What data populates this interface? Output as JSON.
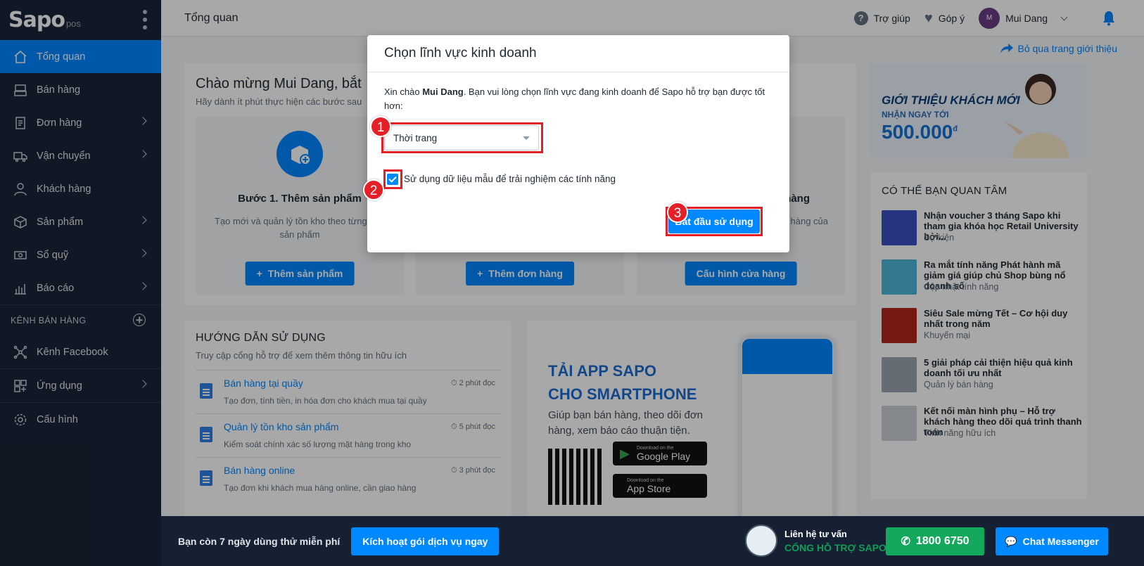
{
  "logo": {
    "brand": "Sapo",
    "suffix": "pos"
  },
  "sidebar": {
    "items": [
      {
        "label": "Tổng quan",
        "icon": "home-icon",
        "active": true
      },
      {
        "label": "Bán hàng",
        "icon": "pos-icon"
      },
      {
        "label": "Đơn hàng",
        "icon": "order-icon"
      },
      {
        "label": "Vận chuyển",
        "icon": "truck-icon"
      },
      {
        "label": "Khách hàng",
        "icon": "user-icon"
      },
      {
        "label": "Sản phẩm",
        "icon": "box-icon"
      },
      {
        "label": "Sổ quỹ",
        "icon": "cash-icon"
      },
      {
        "label": "Báo cáo",
        "icon": "chart-icon"
      }
    ],
    "section_title": "KÊNH BÁN HÀNG",
    "channels": [
      {
        "label": "Kênh Facebook",
        "icon": "facebook-network-icon"
      }
    ],
    "bottom_items": [
      {
        "label": "Ứng dụng",
        "icon": "apps-icon"
      },
      {
        "label": "Cấu hình",
        "icon": "gear-icon"
      }
    ]
  },
  "header": {
    "title": "Tổng quan",
    "help": "Trợ giúp",
    "feedback": "Góp ý",
    "avatar_initial": "M",
    "user_name": "Mui Dang"
  },
  "skip_intro": "Bỏ qua trang giới thiệu",
  "welcome": {
    "title": "Chào mừng Mui Dang, bắt",
    "subtitle": "Hãy dành ít phút thực hiện các bước sau",
    "steps": [
      {
        "title": "Bước 1. Thêm sản phẩm",
        "desc": "Tạo mới và quản lý tồn kho theo từng bản sản phẩm",
        "button": "Thêm sản phẩm"
      },
      {
        "title": "",
        "desc": "",
        "button": "Thêm đơn hàng"
      },
      {
        "title": "ửa hàng",
        "desc": "bán hàng của",
        "button": "Cấu hình cửa hàng"
      }
    ]
  },
  "promo": {
    "line1": "GIỚI THIỆU KHÁCH MỚI",
    "line2": "NHẬN NGAY TỚI",
    "amount": "500.000",
    "currency": "đ"
  },
  "interest": {
    "title": "CÓ THỂ BẠN QUAN TÂM",
    "items": [
      {
        "title": "Nhận voucher 3 tháng Sapo khi tham gia khóa học Retail University bởi...",
        "category": "Sự kiện"
      },
      {
        "title": "Ra mắt tính năng Phát hành mã giảm giá giúp chủ Shop bùng nổ doanh số",
        "category": "Cập nhật tính năng"
      },
      {
        "title": "Siêu Sale mừng Tết – Cơ hội duy nhất trong năm",
        "category": "Khuyến mại"
      },
      {
        "title": "5 giải pháp cải thiện hiệu quả kinh doanh tối ưu nhất",
        "category": "Quản lý bán hàng"
      },
      {
        "title": "Kết nối màn hình phụ – Hỗ trợ khách hàng theo dõi quá trình thanh toán",
        "category": "Tính năng hữu ích"
      }
    ]
  },
  "guide": {
    "title": "HƯỚNG DẪN SỬ DỤNG",
    "subtitle": "Truy cập cổng hỗ trợ để xem thêm thông tin hữu ích",
    "items": [
      {
        "title": "Bán hàng tại quầy",
        "time": "2 phút đọc",
        "desc": "Tạo đơn, tính tiền, in hóa đơn cho khách mua tại quầy"
      },
      {
        "title": "Quản lý tồn kho sản phẩm",
        "time": "5 phút đọc",
        "desc": "Kiểm soát chính xác số lượng mặt hàng trong kho"
      },
      {
        "title": "Bán hàng online",
        "time": "3 phút đọc",
        "desc": "Tạo đơn khi khách mua hàng online, cần giao hàng"
      }
    ]
  },
  "app": {
    "title1": "TẢI APP SAPO",
    "title2": "CHO SMARTPHONE",
    "desc": "Giúp bạn bán hàng, theo dõi đơn hàng, xem báo cáo thuận tiện.",
    "google_small": "Download on the",
    "google_big": "Google Play",
    "apple_small": "Download on the",
    "apple_big": "App Store"
  },
  "bottom": {
    "trial": "Bạn còn 7 ngày dùng thử miễn phí",
    "activate": "Kích hoạt gói dịch vụ ngay",
    "consult_1": "Liên hệ tư vấn",
    "consult_2": "CỔNG HỖ TRỢ SAPO",
    "phone": "1800 6750",
    "messenger": "Chat Messenger"
  },
  "modal": {
    "title": "Chọn lĩnh vực kinh doanh",
    "intro_prefix": "Xin chào ",
    "intro_name": "Mui Dang",
    "intro_suffix": ". Bạn vui lòng chọn lĩnh vực đang kinh doanh để Sapo hỗ trợ bạn được tốt hơn:",
    "select_value": "Thời trang",
    "checkbox_label": "Sử dụng dữ liệu mẫu để trải nghiệm các tính năng",
    "checkbox_checked": true,
    "start_button": "Bắt đầu sử dụng"
  },
  "annotations": {
    "badge1": "1",
    "badge2": "2",
    "badge3": "3",
    "highlight_color": "#e61e25"
  },
  "colors": {
    "primary": "#0088ff",
    "sidebar_bg": "#182537",
    "annotation_red": "#e61e25"
  }
}
